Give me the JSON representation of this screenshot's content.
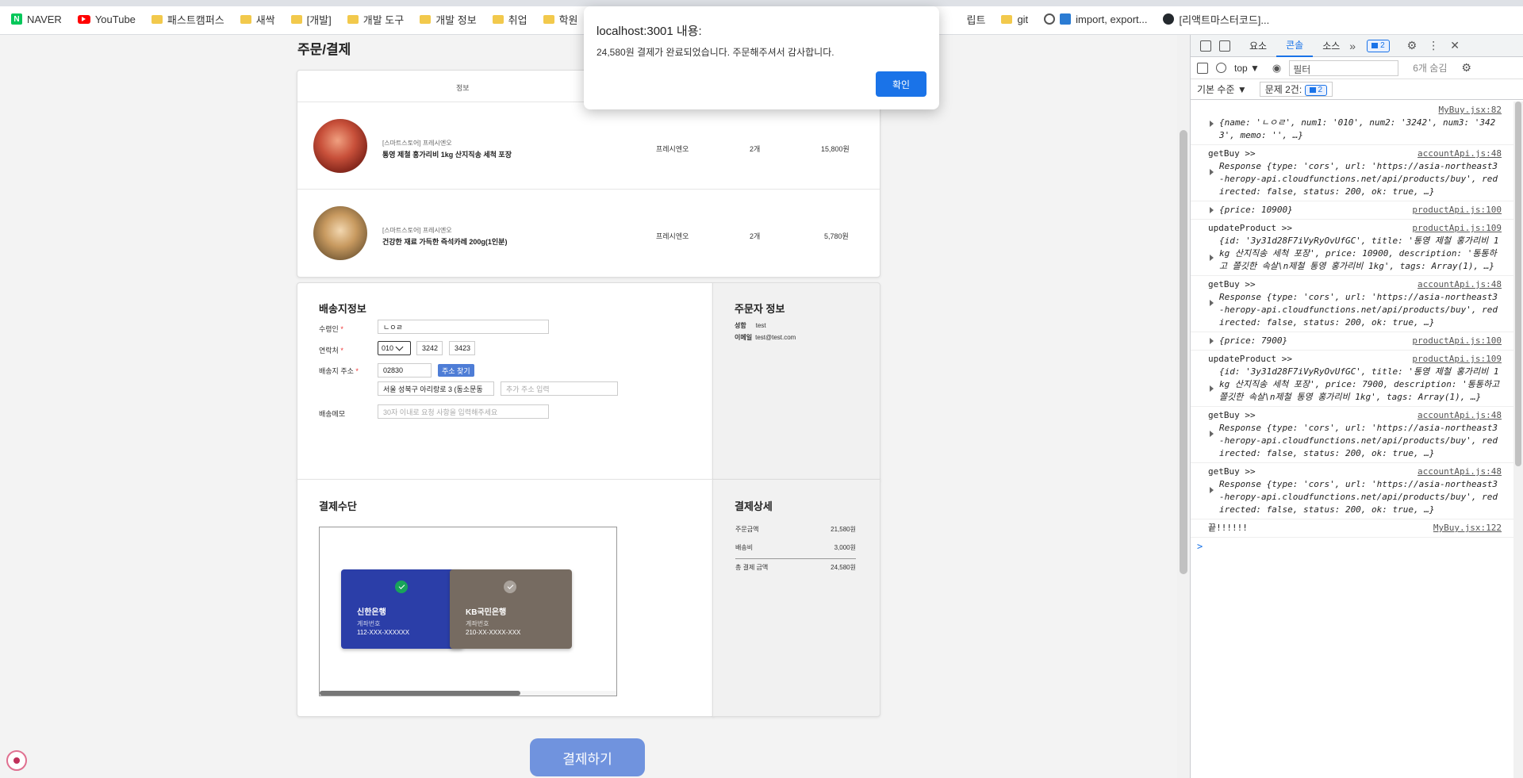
{
  "bookmarks": [
    "NAVER",
    "YouTube",
    "패스트캠퍼스",
    "새싹",
    "[개발]",
    "개발 도구",
    "개발 정보",
    "취업",
    "학원",
    "립트",
    "git",
    "import, export...",
    "[리액트마스터코드]..."
  ],
  "page": {
    "title": "주문/결제",
    "products_header": "정보",
    "products": [
      {
        "store": "[스마트스토어] 프레시엔오",
        "name": "통영 제철 홍가리비 1kg 산지직송 세척 포장",
        "seller": "프레시엔오",
        "qty": "2개",
        "price": "15,800원"
      },
      {
        "store": "[스마트스토어] 프레시엔오",
        "name": "건강한 재료 가득한 즉석카레 200g(1인분)",
        "seller": "프레시엔오",
        "qty": "2개",
        "price": "5,780원"
      }
    ],
    "shipping": {
      "title": "배송지정보",
      "recipient_label": "수령인",
      "recipient_value": "ㄴㅇㄹ",
      "phone_label": "연락처",
      "phone1": "010",
      "phone2": "3242",
      "phone3": "3423",
      "address_label": "배송지 주소",
      "zipcode": "02830",
      "find_button": "주소 찾기",
      "address": "서울 성북구 아리랑로 3 (동소문동",
      "address_detail_placeholder": "추가 주소 입력",
      "memo_label": "배송메모",
      "memo_placeholder": "30자 이내로 요청 사항을 입력해주세요",
      "required_mark": "*"
    },
    "orderer": {
      "title": "주문자 정보",
      "name_label": "성함",
      "name_value": "test",
      "email_label": "이메일",
      "email_value": "test@test.com"
    },
    "payment": {
      "title": "결제수단",
      "banks": [
        {
          "name": "신한은행",
          "account_label": "계좌번호",
          "account": "112-XXX-XXXXXX",
          "color": "#2b3ea8",
          "selected": true
        },
        {
          "name": "KB국민은행",
          "account_label": "계좌번호",
          "account": "210-XX-XXXX-XXX",
          "color": "#766b61",
          "selected": false
        }
      ]
    },
    "detail": {
      "title": "결제상세",
      "rows": [
        {
          "label": "주문금액",
          "value": "21,580원"
        },
        {
          "label": "배송비",
          "value": "3,000원"
        },
        {
          "label": "총 결제 금액",
          "value": "24,580원"
        }
      ]
    },
    "pay_button": "결제하기"
  },
  "dialog": {
    "title": "localhost:3001 내용:",
    "message": "24,580원 결제가 완료되었습니다. 주문해주셔서 감사합니다.",
    "ok": "확인"
  },
  "devtools": {
    "tabs": [
      "요소",
      "콘솔",
      "소스"
    ],
    "active_tab": "콘솔",
    "issues_badge": "2",
    "context": "top",
    "filter_placeholder": "필터",
    "hidden_count": "6개 숨김",
    "level": "기본 수준",
    "issues_label": "문제 2건:",
    "issues_count": "2",
    "logs": [
      {
        "src": "MyBuy.jsx:82",
        "head": "",
        "body": "{name: 'ㄴㅇㄹ', num1: '010', num2: '3242', num3: '3423', memo: '', …}"
      },
      {
        "src": "accountApi.js:48",
        "head": "getBuy >>",
        "body": "Response {type: 'cors', url: 'https://asia-northeast3-heropy-api.cloudfunctions.net/api/products/buy', redirected: false, status: 200, ok: true, …}"
      },
      {
        "src": "productApi.js:100",
        "head": "",
        "body": "{price: 10900}"
      },
      {
        "src": "productApi.js:109",
        "head": "updateProduct >>",
        "body": "{id: '3y31d28F7iVyRyOvUfGC', title: '통영 제철 홍가리비 1kg 산지직송 세척 포장', price: 10900, description: '통통하고 쫄깃한 속살\\n제철 통영 홍가리비 1kg', tags: Array(1), …}"
      },
      {
        "src": "accountApi.js:48",
        "head": "getBuy >>",
        "body": "Response {type: 'cors', url: 'https://asia-northeast3-heropy-api.cloudfunctions.net/api/products/buy', redirected: false, status: 200, ok: true, …}"
      },
      {
        "src": "productApi.js:100",
        "head": "",
        "body": "{price: 7900}"
      },
      {
        "src": "productApi.js:109",
        "head": "updateProduct >>",
        "body": "{id: '3y31d28F7iVyRyOvUfGC', title: '통영 제철 홍가리비 1kg 산지직송 세척 포장', price: 7900, description: '통통하고 쫄깃한 속살\\n제철 통영 홍가리비 1kg', tags: Array(1), …}"
      },
      {
        "src": "accountApi.js:48",
        "head": "getBuy >>",
        "body": "Response {type: 'cors', url: 'https://asia-northeast3-heropy-api.cloudfunctions.net/api/products/buy', redirected: false, status: 200, ok: true, …}"
      },
      {
        "src": "accountApi.js:48",
        "head": "getBuy >>",
        "body": "Response {type: 'cors', url: 'https://asia-northeast3-heropy-api.cloudfunctions.net/api/products/buy', redirected: false, status: 200, ok: true, …}"
      },
      {
        "src": "MyBuy.jsx:122",
        "head": "끝!!!!!!",
        "body": ""
      }
    ],
    "prompt": ">"
  }
}
